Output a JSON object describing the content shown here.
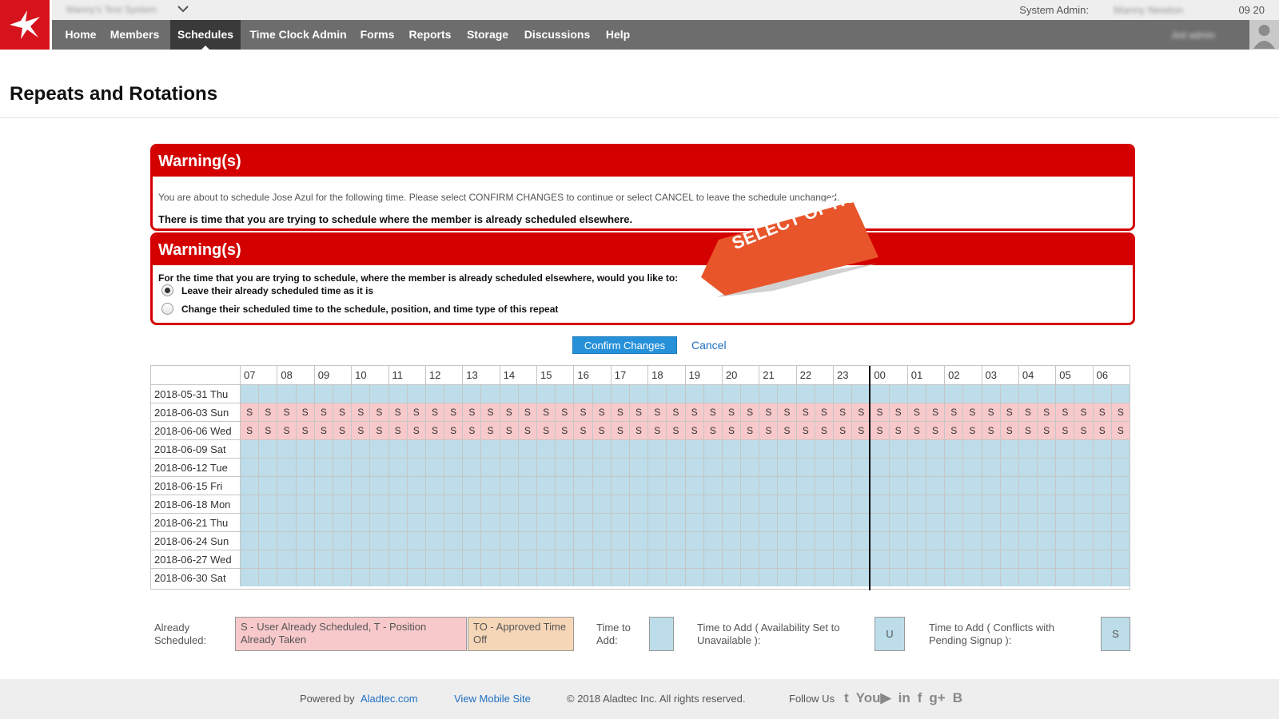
{
  "topbar": {
    "system_name": "Manny's Test System",
    "admin_label": "System Admin:",
    "admin_name": "Manny Newton",
    "time_tag": "09 20",
    "user_name": "Jed admin"
  },
  "nav": {
    "items": [
      {
        "label": "Home"
      },
      {
        "label": "Members"
      },
      {
        "label": "Schedules"
      },
      {
        "label": "Time Clock Admin"
      },
      {
        "label": "Forms"
      },
      {
        "label": "Reports"
      },
      {
        "label": "Storage"
      },
      {
        "label": "Discussions"
      },
      {
        "label": "Help"
      }
    ],
    "active": "Schedules"
  },
  "page": {
    "title": "Repeats and Rotations"
  },
  "warning1": {
    "title": "Warning(s)",
    "message": "You are about to schedule Jose Azul for the following time. Please select CONFIRM CHANGES to continue or select CANCEL to leave the schedule unchanged.",
    "strong": "There is time that you are trying to schedule where the member is already scheduled elsewhere."
  },
  "warning2": {
    "title": "Warning(s)",
    "question": "For the time that you are trying to schedule, where the member is already scheduled elsewhere, would you like to:",
    "options": [
      {
        "label": "Leave their already scheduled time as it is",
        "selected": true
      },
      {
        "label": "Change their scheduled time to the schedule, position, and time type of this repeat",
        "selected": false
      }
    ]
  },
  "callout": {
    "text": "SELECT OPTION",
    "color": "#e8552a"
  },
  "actions": {
    "confirm_label": "Confirm Changes",
    "cancel_label": "Cancel"
  },
  "schedule": {
    "hours": [
      "07",
      "08",
      "09",
      "10",
      "11",
      "12",
      "13",
      "14",
      "15",
      "16",
      "17",
      "18",
      "19",
      "20",
      "21",
      "22",
      "23",
      "00",
      "01",
      "02",
      "03",
      "04",
      "05",
      "06"
    ],
    "slot_letter": "S",
    "rows": [
      {
        "date": "2018-05-31 Thu",
        "status": "add"
      },
      {
        "date": "2018-06-03 Sun",
        "status": "scheduled"
      },
      {
        "date": "2018-06-06 Wed",
        "status": "scheduled"
      },
      {
        "date": "2018-06-09 Sat",
        "status": "add"
      },
      {
        "date": "2018-06-12 Tue",
        "status": "add"
      },
      {
        "date": "2018-06-15 Fri",
        "status": "add"
      },
      {
        "date": "2018-06-18 Mon",
        "status": "add"
      },
      {
        "date": "2018-06-21 Thu",
        "status": "add"
      },
      {
        "date": "2018-06-24 Sun",
        "status": "add"
      },
      {
        "date": "2018-06-27 Wed",
        "status": "add"
      },
      {
        "date": "2018-06-30 Sat",
        "status": "add"
      }
    ],
    "colors": {
      "add": "#bcdde9",
      "scheduled": "#f8c9cb"
    }
  },
  "legend": {
    "already_label": "Already Scheduled:",
    "already_box": "S - User Already Scheduled, T - Position Already Taken",
    "to_box": "TO - Approved Time Off",
    "add_label": "Time to Add:",
    "unavail_label": "Time to Add ( Availability Set to Unavailable ):",
    "unavail_box": "U",
    "conflict_label": "Time to Add ( Conflicts with Pending Signup ):",
    "conflict_box": "S"
  },
  "footer": {
    "powered_prefix": "Powered by",
    "powered_link": "Aladtec.com",
    "mobile_link": "View Mobile Site",
    "copyright": "© 2018 Aladtec Inc. All rights reserved.",
    "follow": "Follow Us",
    "social_icons": [
      "twitter-icon",
      "youtube-icon",
      "linkedin-icon",
      "facebook-icon",
      "googleplus-icon",
      "blogger-icon"
    ]
  }
}
